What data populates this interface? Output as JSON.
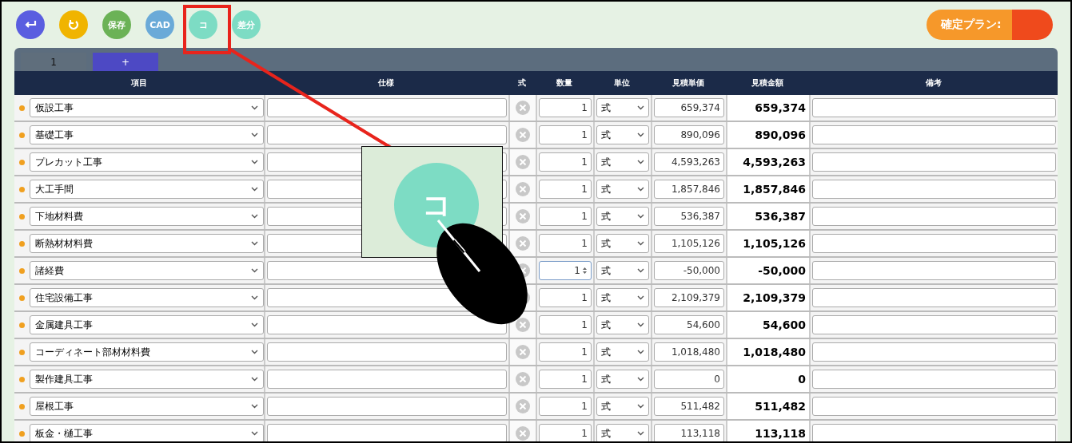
{
  "toolbar": {
    "buttons": [
      {
        "kind": "back",
        "color": "#5a5ee0"
      },
      {
        "kind": "undo",
        "color": "#f0b400"
      },
      {
        "kind": "text",
        "label": "保存",
        "color": "#6bb256"
      },
      {
        "kind": "text",
        "label": "CAD",
        "color": "#6aaad8"
      },
      {
        "kind": "text",
        "label": "コ",
        "color": "#7ddcc4"
      },
      {
        "kind": "text",
        "label": "差分",
        "color": "#7ddcc4"
      }
    ],
    "plan_button": "確定プラン:"
  },
  "tabs": [
    {
      "label": "1",
      "selected": true
    },
    {
      "label": "+",
      "selected": false
    }
  ],
  "table": {
    "columns": [
      "項目",
      "仕様",
      "式",
      "数量",
      "単位",
      "見積単価",
      "見積金額",
      "備考"
    ],
    "rows": [
      {
        "item": "仮設工事",
        "qty": "1",
        "unit": "式",
        "price": "659,374",
        "amount": "659,374",
        "focused": false
      },
      {
        "item": "基礎工事",
        "qty": "1",
        "unit": "式",
        "price": "890,096",
        "amount": "890,096",
        "focused": false
      },
      {
        "item": "プレカット工事",
        "qty": "1",
        "unit": "式",
        "price": "4,593,263",
        "amount": "4,593,263",
        "focused": false
      },
      {
        "item": "大工手間",
        "qty": "1",
        "unit": "式",
        "price": "1,857,846",
        "amount": "1,857,846",
        "focused": false
      },
      {
        "item": "下地材料費",
        "qty": "1",
        "unit": "式",
        "price": "536,387",
        "amount": "536,387",
        "focused": false
      },
      {
        "item": "断熱材材料費",
        "qty": "1",
        "unit": "式",
        "price": "1,105,126",
        "amount": "1,105,126",
        "focused": false
      },
      {
        "item": "諸経費",
        "qty": "1",
        "unit": "式",
        "price": "-50,000",
        "amount": "-50,000",
        "focused": true
      },
      {
        "item": "住宅設備工事",
        "qty": "1",
        "unit": "式",
        "price": "2,109,379",
        "amount": "2,109,379",
        "focused": false
      },
      {
        "item": "金属建具工事",
        "qty": "1",
        "unit": "式",
        "price": "54,600",
        "amount": "54,600",
        "focused": false
      },
      {
        "item": "コーディネート部材材料費",
        "qty": "1",
        "unit": "式",
        "price": "1,018,480",
        "amount": "1,018,480",
        "focused": false
      },
      {
        "item": "製作建具工事",
        "qty": "1",
        "unit": "式",
        "price": "0",
        "amount": "0",
        "focused": false
      },
      {
        "item": "屋根工事",
        "qty": "1",
        "unit": "式",
        "price": "511,482",
        "amount": "511,482",
        "focused": false
      },
      {
        "item": "板金・樋工事",
        "qty": "1",
        "unit": "式",
        "price": "113,118",
        "amount": "113,118",
        "focused": false
      }
    ]
  },
  "callout": {
    "button_label": "コ"
  }
}
